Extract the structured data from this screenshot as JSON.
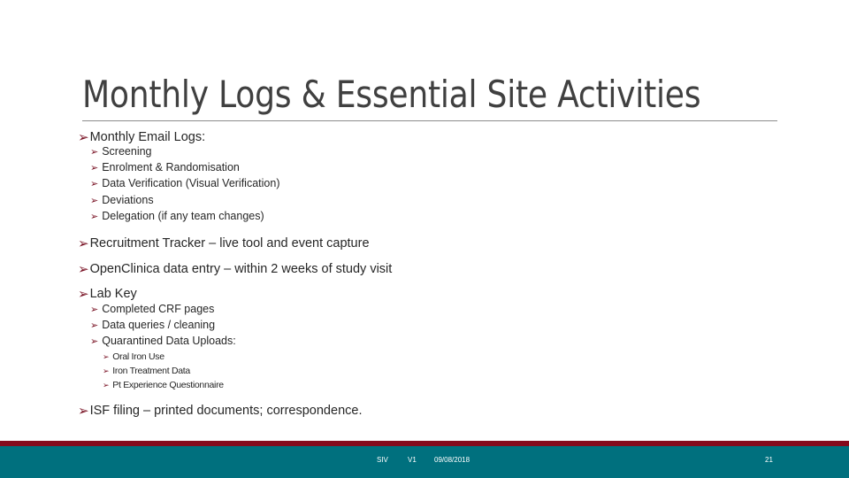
{
  "slide": {
    "title": "Monthly Logs & Essential Site Activities",
    "bullet_glyph": "➢",
    "colors": {
      "bullet": "#7a1426",
      "footer_red": "#850a1c",
      "footer_teal": "#00707e",
      "title": "#404040"
    },
    "items": [
      {
        "level": 1,
        "text": "Monthly Email Logs:"
      },
      {
        "level": 2,
        "text": "Screening"
      },
      {
        "level": 2,
        "text": "Enrolment & Randomisation"
      },
      {
        "level": 2,
        "text": "Data Verification (Visual Verification)"
      },
      {
        "level": 2,
        "text": "Deviations"
      },
      {
        "level": 2,
        "text": "Delegation (if any team changes)"
      },
      {
        "level": 1,
        "text": "Recruitment Tracker – live tool and event capture"
      },
      {
        "level": 1,
        "text": "OpenClinica data entry – within 2 weeks of study visit"
      },
      {
        "level": 1,
        "text": "Lab Key"
      },
      {
        "level": 2,
        "text": "Completed CRF pages"
      },
      {
        "level": 2,
        "text": "Data queries / cleaning"
      },
      {
        "level": 2,
        "text": "Quarantined Data Uploads:"
      },
      {
        "level": 3,
        "text": "Oral Iron Use"
      },
      {
        "level": 3,
        "text": "Iron Treatment Data"
      },
      {
        "level": 3,
        "text": "Pt Experience Questionnaire"
      },
      {
        "level": 1,
        "text": "ISF filing – printed documents; correspondence."
      }
    ]
  },
  "footer": {
    "label": "SIV",
    "version": "V1",
    "date": "09/08/2018",
    "page_number": "21"
  }
}
